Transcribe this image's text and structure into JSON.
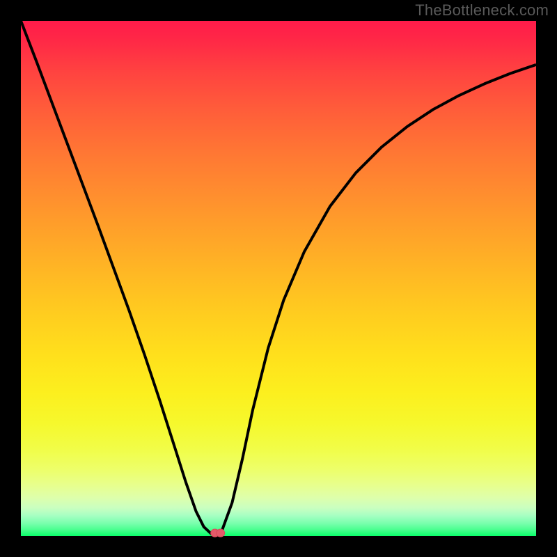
{
  "watermark": "TheBottleneck.com",
  "chart_data": {
    "type": "line",
    "title": "",
    "xlabel": "",
    "ylabel": "",
    "xlim": [
      0,
      1
    ],
    "ylim": [
      0,
      1
    ],
    "series": [
      {
        "name": "curve",
        "x": [
          0.0,
          0.03,
          0.06,
          0.09,
          0.12,
          0.15,
          0.18,
          0.21,
          0.24,
          0.27,
          0.3,
          0.32,
          0.34,
          0.355,
          0.37,
          0.38,
          0.39,
          0.41,
          0.43,
          0.45,
          0.48,
          0.51,
          0.55,
          0.6,
          0.65,
          0.7,
          0.75,
          0.8,
          0.85,
          0.9,
          0.95,
          1.0
        ],
        "y": [
          1.0,
          0.922,
          0.842,
          0.762,
          0.682,
          0.602,
          0.52,
          0.438,
          0.352,
          0.262,
          0.168,
          0.105,
          0.048,
          0.018,
          0.004,
          0.002,
          0.01,
          0.065,
          0.15,
          0.245,
          0.365,
          0.458,
          0.552,
          0.64,
          0.705,
          0.755,
          0.795,
          0.828,
          0.855,
          0.878,
          0.898,
          0.915
        ]
      }
    ],
    "marker": {
      "x": 0.382,
      "y": 0.006
    },
    "colors": {
      "gradient_top": "#ff1b4a",
      "gradient_bottom": "#0aff6a",
      "curve": "#000000",
      "marker": "#e55a6a",
      "frame": "#000000"
    }
  }
}
